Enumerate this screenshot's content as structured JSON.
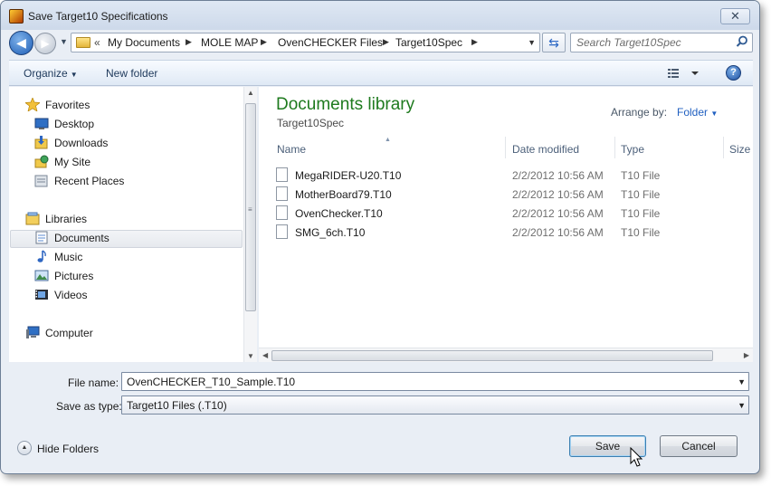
{
  "window": {
    "title": "Save Target10 Specifications",
    "close_glyph": "✕"
  },
  "address": {
    "overflow": "«",
    "crumbs": [
      "My Documents",
      "MOLE MAP",
      "OvenCHECKER Files",
      "Target10Spec"
    ],
    "separator": "▶",
    "dropdown": "▼"
  },
  "search": {
    "placeholder": "Search Target10Spec"
  },
  "toolbar": {
    "organize_label": "Organize",
    "new_folder_label": "New folder",
    "help_glyph": "?"
  },
  "nav": {
    "favorites": {
      "label": "Favorites",
      "items": [
        "Desktop",
        "Downloads",
        "My Site",
        "Recent Places"
      ]
    },
    "libraries": {
      "label": "Libraries",
      "items": [
        "Documents",
        "Music",
        "Pictures",
        "Videos"
      ],
      "selected": "Documents"
    },
    "computer": {
      "label": "Computer"
    }
  },
  "content": {
    "library_title": "Documents library",
    "library_subtitle": "Target10Spec",
    "arrange_label": "Arrange by:",
    "arrange_value": "Folder",
    "columns": [
      "Name",
      "Date modified",
      "Type",
      "Size"
    ],
    "files": [
      {
        "name": "MegaRIDER-U20.T10",
        "date": "2/2/2012 10:56 AM",
        "type": "T10 File"
      },
      {
        "name": "MotherBoard79.T10",
        "date": "2/2/2012 10:56 AM",
        "type": "T10 File"
      },
      {
        "name": "OvenChecker.T10",
        "date": "2/2/2012 10:56 AM",
        "type": "T10 File"
      },
      {
        "name": "SMG_6ch.T10",
        "date": "2/2/2012 10:56 AM",
        "type": "T10 File"
      }
    ]
  },
  "form": {
    "file_name_label": "File name:",
    "file_name_value": "OvenCHECKER_T10_Sample.T10",
    "save_type_label": "Save as type:",
    "save_type_value": "Target10 Files (.T10)"
  },
  "footer": {
    "hide_folders_label": "Hide Folders",
    "save_label": "Save",
    "cancel_label": "Cancel"
  },
  "colors": {
    "library_title": "#1e7a1e",
    "link_blue": "#1f5fc0",
    "accent": "#2a67c4"
  }
}
